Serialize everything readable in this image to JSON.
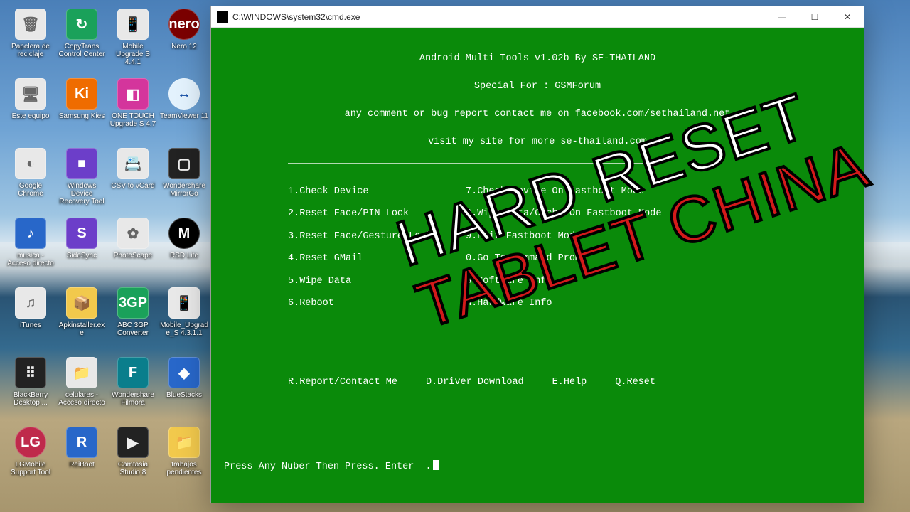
{
  "desktop": {
    "icons": [
      {
        "label": "Papelera de reciclaje",
        "cls": "c-white",
        "glyph": "🗑"
      },
      {
        "label": "CopyTrans Control Center",
        "cls": "c-green",
        "glyph": "↻"
      },
      {
        "label": "Mobile Upgrade S 4.4.1",
        "cls": "c-white",
        "glyph": "📱"
      },
      {
        "label": "Nero 12",
        "cls": "c-nero",
        "glyph": "nero"
      },
      {
        "label": "Este equipo",
        "cls": "c-white",
        "glyph": "🖥"
      },
      {
        "label": "Samsung Kies",
        "cls": "c-orange",
        "glyph": "Ki"
      },
      {
        "label": "ONE TOUCH Upgrade S 4.7",
        "cls": "c-pink",
        "glyph": "◧"
      },
      {
        "label": "TeamViewer 11",
        "cls": "c-tv",
        "glyph": "↔"
      },
      {
        "label": "Google Chrome",
        "cls": "c-white",
        "glyph": "◐"
      },
      {
        "label": "Windows Device Recovery Tool",
        "cls": "c-purple",
        "glyph": "■"
      },
      {
        "label": "CSV to vCard",
        "cls": "c-white",
        "glyph": "📇"
      },
      {
        "label": "Wondershare MirrorGo",
        "cls": "c-black",
        "glyph": "▢"
      },
      {
        "label": "musica - Acceso directo",
        "cls": "c-blue",
        "glyph": "♪"
      },
      {
        "label": "SideSync",
        "cls": "c-purple",
        "glyph": "S"
      },
      {
        "label": "PhotoScape",
        "cls": "c-white",
        "glyph": "✿"
      },
      {
        "label": "RSD Lite",
        "cls": "c-moto",
        "glyph": "M"
      },
      {
        "label": "iTunes",
        "cls": "c-white",
        "glyph": "♫"
      },
      {
        "label": "Apkinstaller.exe",
        "cls": "c-yellow",
        "glyph": "📦"
      },
      {
        "label": "ABC 3GP Converter",
        "cls": "c-green",
        "glyph": "3GP"
      },
      {
        "label": "Mobile_Upgrade_S 4.3.1.1",
        "cls": "c-white",
        "glyph": "📱"
      },
      {
        "label": "BlackBerry Desktop ...",
        "cls": "c-black",
        "glyph": "⠿"
      },
      {
        "label": "celulares - Acceso directo",
        "cls": "c-white",
        "glyph": "📁"
      },
      {
        "label": "Wondershare Filmora",
        "cls": "c-teal",
        "glyph": "F"
      },
      {
        "label": "BlueStacks",
        "cls": "c-blue",
        "glyph": "◆"
      },
      {
        "label": "LGMobile Support Tool",
        "cls": "c-lg",
        "glyph": "LG"
      },
      {
        "label": "ReiBoot",
        "cls": "c-blue",
        "glyph": "R"
      },
      {
        "label": "Camtasia Studio 8",
        "cls": "c-black",
        "glyph": "▶"
      },
      {
        "label": "trabajos pendientes",
        "cls": "c-yellow",
        "glyph": "📁"
      }
    ]
  },
  "cmd": {
    "title": "C:\\WINDOWS\\system32\\cmd.exe",
    "header1": "Android Multi Tools v1.02b By SE-THAILAND",
    "header2": "Special For : GSMForum",
    "header3": "any comment or bug report contact me on facebook.com/sethailand.net",
    "header4": "visit my site for more se-thailand.com",
    "left": [
      "1.Check Device",
      "2.Reset Face/PIN Lock",
      "3.Reset Face/Gesture Lock",
      "4.Reset GMail",
      "5.Wipe Data",
      "6.Reboot"
    ],
    "right": [
      "7.Check Device On Fastboot Mode",
      "8.Wipe Data/Cache On Fastboot Mode",
      "9.Exit Fastboot Mode",
      "0.Go To Command Promt",
      "S.Software Info",
      "H.Hardware Info"
    ],
    "bottom": [
      "R.Report/Contact Me",
      "D.Driver Download",
      "E.Help",
      "Q.Reset"
    ],
    "prompt": "Press Any Nuber Then Press. Enter  ."
  },
  "overlay": {
    "line1": "HARD RESET",
    "line2": "TABLET CHINA"
  }
}
